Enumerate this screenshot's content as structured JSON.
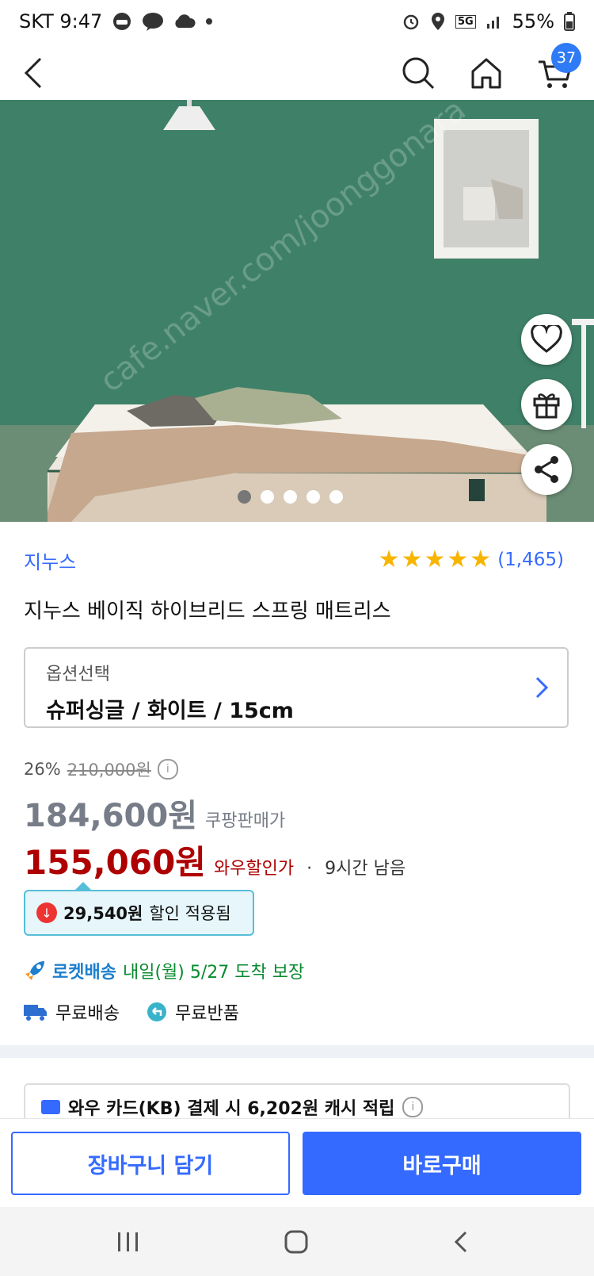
{
  "status_bar": {
    "carrier_time": "SKT 9:47",
    "network": "5G",
    "battery": "55%"
  },
  "topnav": {
    "cart_count": "37"
  },
  "hero": {
    "watermark": "cafe.naver.com/joonggonara",
    "slide_count": 5,
    "active_slide": 1
  },
  "product": {
    "brand": "지누스",
    "rating_count": "(1,465)",
    "stars": 5,
    "title": "지누스 베이직 하이브리드 스프링 매트리스",
    "option_label": "옵션선택",
    "option_value": "슈퍼싱글 / 화이트 / 15cm"
  },
  "pricing": {
    "discount_rate": "26%",
    "original_price": "210,000원",
    "info_glyph": "i",
    "coupang_price": "184,600원",
    "coupang_label": "쿠팡판매가",
    "wow_price": "155,060원",
    "wow_label": "와우할인가",
    "bullet": "·",
    "time_left": "9시간 남음",
    "coupon_amount": "29,540원",
    "coupon_text": "할인 적용됨"
  },
  "delivery": {
    "rocket_label": "로켓배송",
    "rocket_text": "내일(월) 5/27 도착 보장",
    "free_shipping": "무료배송",
    "free_return": "무료반품"
  },
  "card_offer": {
    "text": "와우 카드(KB) 결제 시 6,202원 캐시 적립"
  },
  "actions": {
    "add_to_cart": "장바구니 담기",
    "buy_now": "바로구매"
  },
  "colors": {
    "accent": "#346aff",
    "wow_red": "#ae0000",
    "rocket_green": "#0a8a2f",
    "star": "#f7b500"
  }
}
